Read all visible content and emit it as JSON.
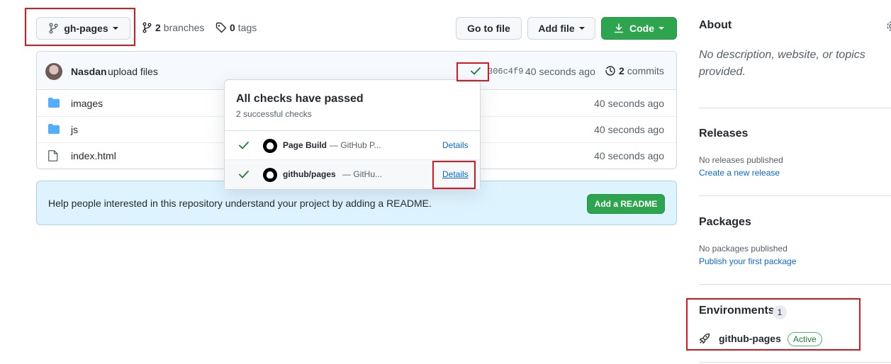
{
  "toolbar": {
    "branch": "gh-pages",
    "branches_count": "2",
    "branches_label": "branches",
    "tags_count": "0",
    "tags_label": "tags",
    "go_to_file": "Go to file",
    "add_file": "Add file",
    "code": "Code"
  },
  "commit": {
    "author": "Nasdan",
    "message": "upload files",
    "sha": "306c4f9",
    "time": "40 seconds ago",
    "commits_count": "2",
    "commits_label": "commits"
  },
  "files": [
    {
      "name": "images",
      "type": "folder",
      "age": "40 seconds ago"
    },
    {
      "name": "js",
      "type": "folder",
      "age": "40 seconds ago"
    },
    {
      "name": "index.html",
      "type": "file",
      "age": "40 seconds ago"
    }
  ],
  "checks_popover": {
    "title": "All checks have passed",
    "subtitle": "2 successful checks",
    "checks": [
      {
        "name": "Page Build",
        "desc": "— GitHub P...",
        "details": "Details"
      },
      {
        "name": "github/pages",
        "desc": "— GitHu...",
        "details": "Details"
      }
    ]
  },
  "readme_banner": {
    "text": "Help people interested in this repository understand your project by adding a README.",
    "button": "Add a README"
  },
  "sidebar": {
    "about_title": "About",
    "about_text": "No description, website, or topics provided.",
    "releases_title": "Releases",
    "releases_none": "No releases published",
    "releases_link": "Create a new release",
    "packages_title": "Packages",
    "packages_none": "No packages published",
    "packages_link": "Publish your first package",
    "environments_title": "Environments",
    "environments_count": "1",
    "environment_name": "github-pages",
    "environment_status": "Active"
  },
  "colors": {
    "accent_green": "#2da44e",
    "link_blue": "#0969da",
    "folder_blue": "#54aeff",
    "annotation_red": "#e0161e"
  }
}
